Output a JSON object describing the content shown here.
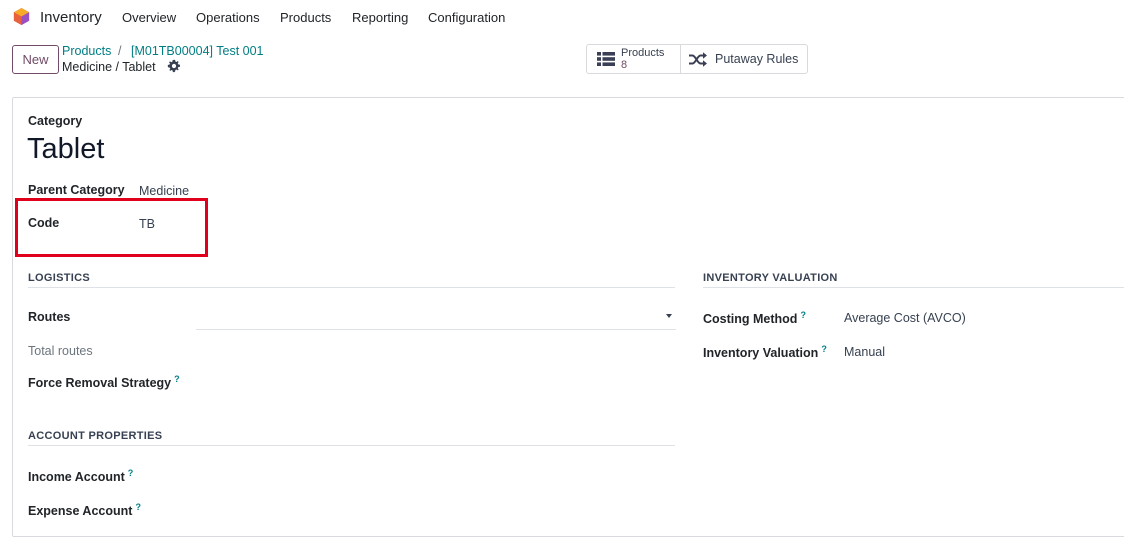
{
  "navbar": {
    "app_name": "Inventory",
    "menu": [
      "Overview",
      "Operations",
      "Products",
      "Reporting",
      "Configuration"
    ]
  },
  "control_panel": {
    "new_label": "New",
    "breadcrumb": [
      "Products",
      "[M01TB00004] Test 001"
    ],
    "breadcrumb_separator": "/",
    "record_title": "Medicine / Tablet",
    "smart_buttons": {
      "products_label": "Products",
      "products_count": "8",
      "putaway_label": "Putaway Rules"
    }
  },
  "form": {
    "category_label": "Category",
    "category_name": "Tablet",
    "parent_category_label": "Parent Category",
    "parent_category_value": "Medicine",
    "code_label": "Code",
    "code_value": "TB",
    "logistics": {
      "title": "LOGISTICS",
      "routes_label": "Routes",
      "routes_value": "",
      "total_routes_label": "Total routes",
      "force_removal_label": "Force Removal Strategy"
    },
    "account_properties": {
      "title": "ACCOUNT PROPERTIES",
      "income_label": "Income Account",
      "expense_label": "Expense Account"
    },
    "inventory_valuation": {
      "title": "INVENTORY VALUATION",
      "costing_method_label": "Costing Method",
      "costing_method_value": "Average Cost (AVCO)",
      "valuation_label": "Inventory Valuation",
      "valuation_value": "Manual"
    },
    "help_mark": "?"
  },
  "colors": {
    "brand": "#714b67",
    "link": "#017e84",
    "highlight": "#e0001b"
  }
}
